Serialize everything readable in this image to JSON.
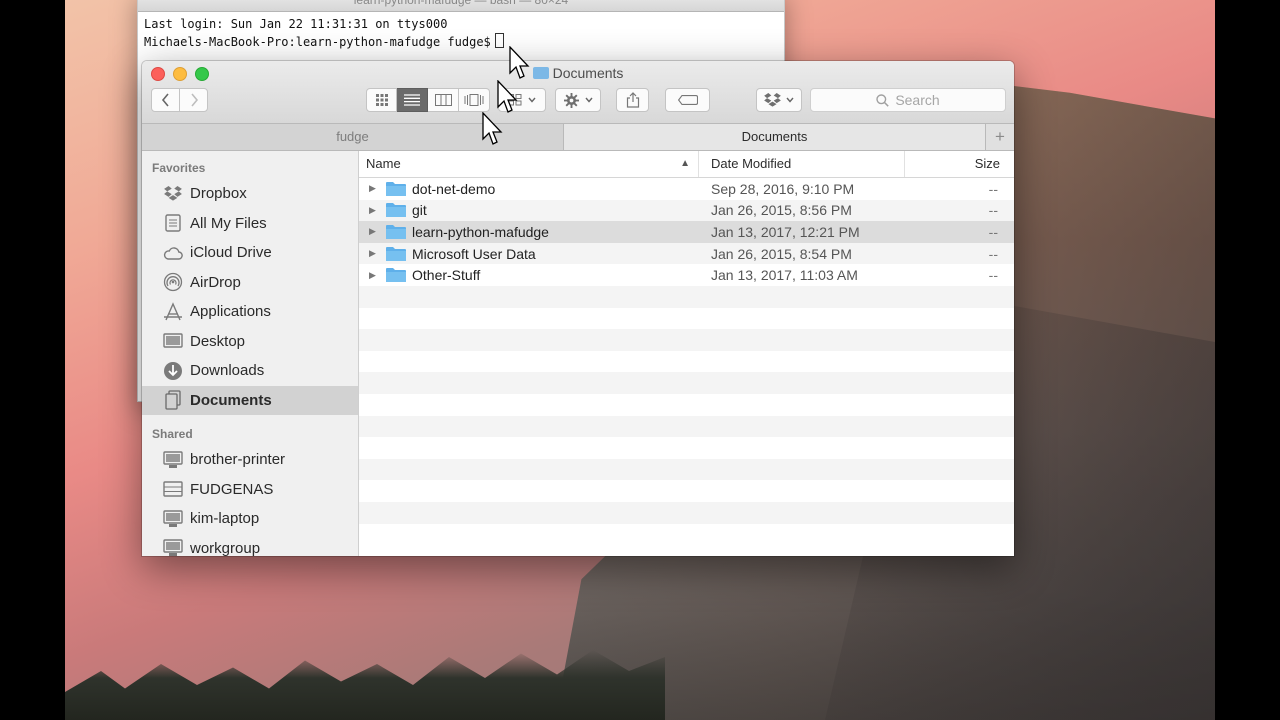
{
  "terminal": {
    "title": "learn-python-mafudge — bash — 80×24",
    "lines": [
      "Last login: Sun Jan 22 11:31:31 on ttys000",
      "Michaels-MacBook-Pro:learn-python-mafudge fudge$"
    ]
  },
  "finder": {
    "title": "Documents",
    "search_placeholder": "Search",
    "tabs": [
      {
        "label": "fudge",
        "active": false
      },
      {
        "label": "Documents",
        "active": true
      }
    ],
    "tab_add_label": "+",
    "sidebar": {
      "favorites_heading": "Favorites",
      "favorites": [
        {
          "label": "Dropbox",
          "icon": "dropbox-icon"
        },
        {
          "label": "All My Files",
          "icon": "all-files-icon"
        },
        {
          "label": "iCloud Drive",
          "icon": "cloud-icon"
        },
        {
          "label": "AirDrop",
          "icon": "airdrop-icon"
        },
        {
          "label": "Applications",
          "icon": "applications-icon"
        },
        {
          "label": "Desktop",
          "icon": "desktop-icon"
        },
        {
          "label": "Downloads",
          "icon": "downloads-icon"
        },
        {
          "label": "Documents",
          "icon": "documents-icon",
          "selected": true
        }
      ],
      "shared_heading": "Shared",
      "shared": [
        {
          "label": "brother-printer",
          "icon": "computer-icon"
        },
        {
          "label": "FUDGENAS",
          "icon": "server-icon"
        },
        {
          "label": "kim-laptop",
          "icon": "computer-icon"
        },
        {
          "label": "workgroup",
          "icon": "computer-icon"
        }
      ]
    },
    "columns": {
      "name": "Name",
      "date": "Date Modified",
      "size": "Size"
    },
    "files": [
      {
        "name": "dot-net-demo",
        "date": "Sep 28, 2016, 9:10 PM",
        "size": "--"
      },
      {
        "name": "git",
        "date": "Jan 26, 2015, 8:56 PM",
        "size": "--"
      },
      {
        "name": "learn-python-mafudge",
        "date": "Jan 13, 2017, 12:21 PM",
        "size": "--",
        "highlighted": true
      },
      {
        "name": "Microsoft User Data",
        "date": "Jan 26, 2015, 8:54 PM",
        "size": "--"
      },
      {
        "name": "Other-Stuff",
        "date": "Jan 13, 2017, 11:03 AM",
        "size": "--"
      }
    ]
  },
  "colors": {
    "close": "#fc605b",
    "minimize": "#fdbc40",
    "maximize": "#34c84a",
    "folder": "#5fb0ea",
    "selection": "#d2d2d2"
  }
}
